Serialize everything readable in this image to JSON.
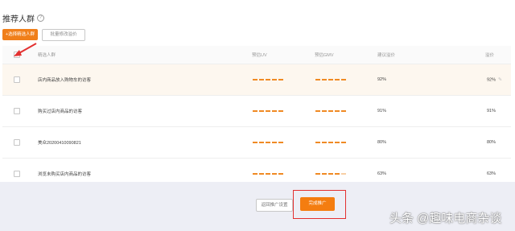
{
  "page": {
    "title": "推荐人群",
    "add_button": "+选择精选人群",
    "batch_button": "批量修改溢价"
  },
  "table": {
    "headers": [
      "精选人群",
      "预估UV",
      "预估GMV",
      "建议溢价",
      "溢价"
    ],
    "rows": [
      {
        "name": "店内商品放入购物车的访客",
        "level_uv": 5,
        "level_gmv": 5,
        "suggest": "92%",
        "premium": "92%"
      },
      {
        "name": "购买过店内商品的访客",
        "level_uv": 5,
        "level_gmv": 5,
        "suggest": "91%",
        "premium": "91%"
      },
      {
        "name": "美众20200410090821",
        "level_uv": 5,
        "level_gmv": 5,
        "suggest": "80%",
        "premium": "80%"
      },
      {
        "name": "浏览未购买店内商品的访客",
        "level_uv": 5,
        "level_gmv": 4,
        "suggest": "63%",
        "premium": "63%"
      }
    ]
  },
  "footer": {
    "back_button": "返回推广设置",
    "done_button": "完成推广"
  },
  "watermark": "头条 @趣味电商杂谈",
  "colors": {
    "accent": "#f07f1a",
    "annotation_red": "#e33030",
    "footer_bg": "#edeef5"
  }
}
